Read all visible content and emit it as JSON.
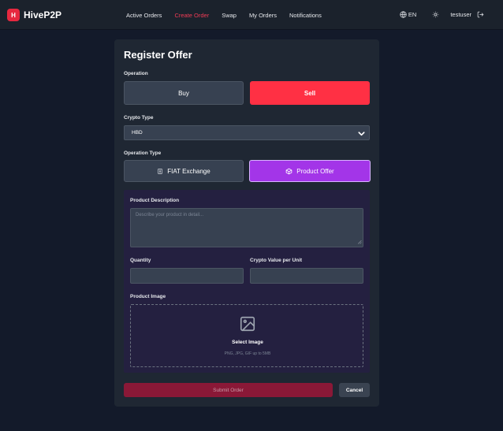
{
  "brand": {
    "logo_letter": "H",
    "name": "HiveP2P",
    "accent": "#e6283f"
  },
  "nav": {
    "links": [
      {
        "label": "Active Orders",
        "active": false
      },
      {
        "label": "Create Order",
        "active": true
      },
      {
        "label": "Swap",
        "active": false
      },
      {
        "label": "My Orders",
        "active": false
      },
      {
        "label": "Notifications",
        "active": false
      }
    ],
    "language": "EN",
    "username": "testuser"
  },
  "form": {
    "title": "Register Offer",
    "operation": {
      "label": "Operation",
      "buy": "Buy",
      "sell": "Sell",
      "selected": "Sell"
    },
    "crypto_type": {
      "label": "Crypto Type",
      "value": "HBD"
    },
    "operation_type": {
      "label": "Operation Type",
      "fiat": "FIAT Exchange",
      "product": "Product Offer",
      "selected": "Product Offer"
    },
    "product": {
      "description_label": "Product Description",
      "description_placeholder": "Describe your product in detail...",
      "quantity_label": "Quantity",
      "crypto_value_label": "Crypto Value per Unit",
      "image_label": "Product Image",
      "select_image": "Select Image",
      "image_hint": "PNG, JPG, GIF up to 5MB"
    },
    "submit": "Submit Order",
    "cancel": "Cancel"
  },
  "colors": {
    "sell": "#ff3044",
    "product": "#a335e8",
    "submit": "#8a1837",
    "background": "#131a2a",
    "card": "#1f2733"
  }
}
